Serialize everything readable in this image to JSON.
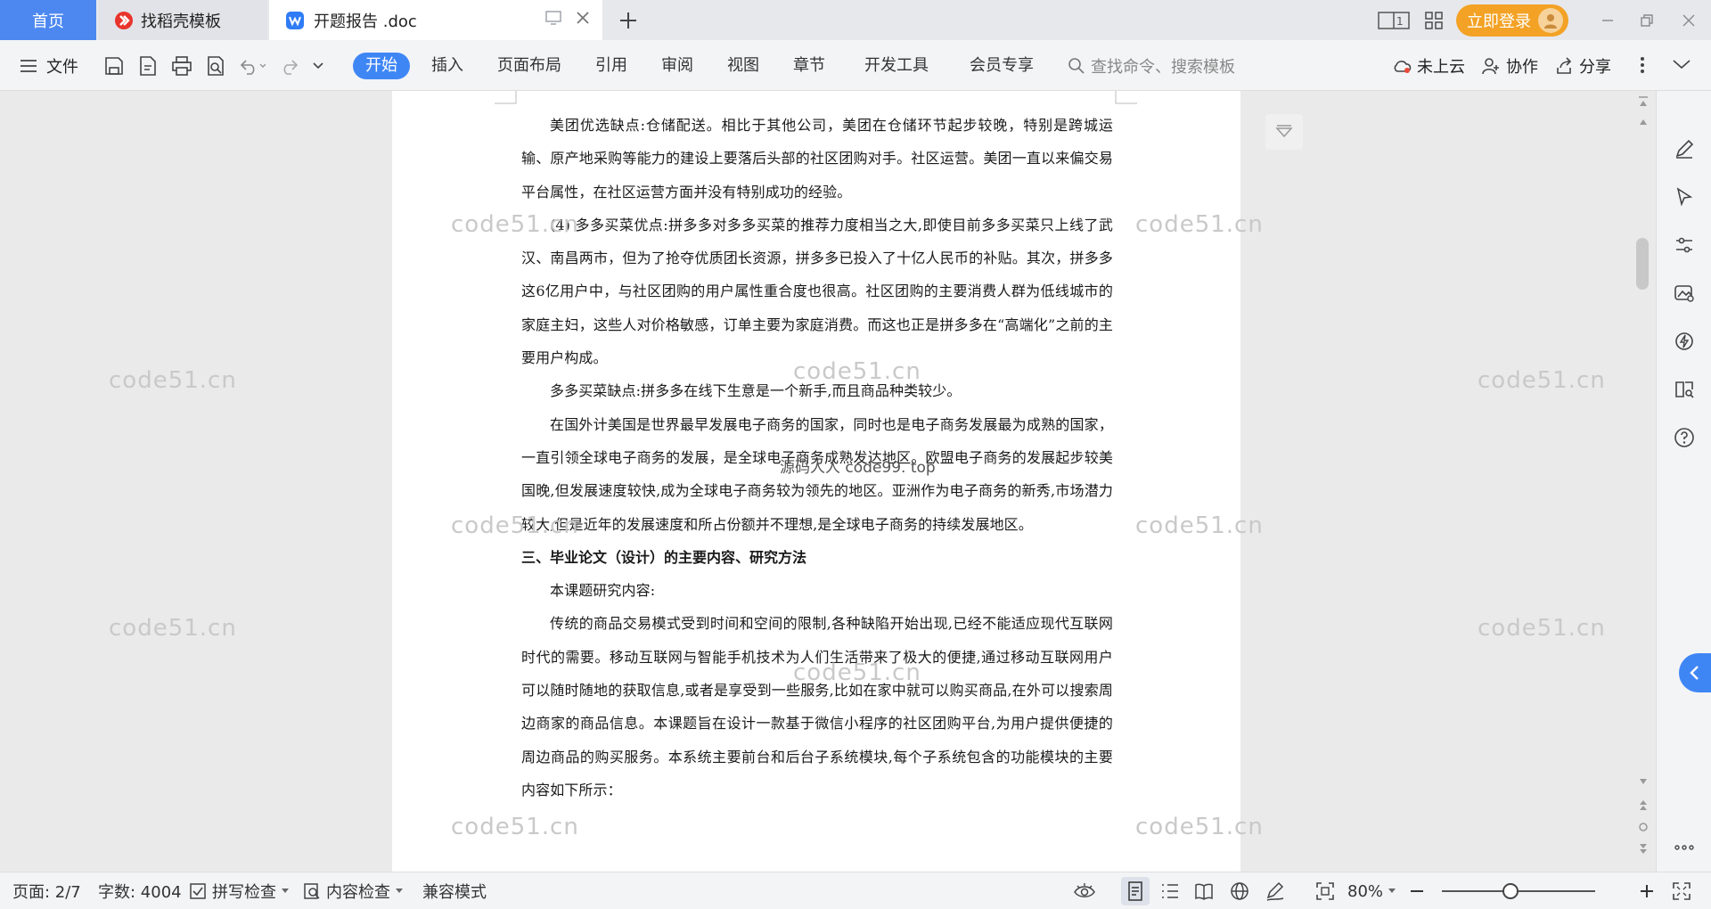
{
  "tabs": {
    "home": "首页",
    "daoke": "找稻壳模板",
    "doc": "开题报告 .doc",
    "new_tab": "+"
  },
  "titlebar": {
    "login": "立即登录"
  },
  "ribbon": {
    "file": "文件",
    "menu_tabs": [
      "开始",
      "插入",
      "页面布局",
      "引用",
      "审阅",
      "视图",
      "章节",
      "开发工具",
      "会员专享"
    ],
    "search_placeholder": "查找命令、搜索模板",
    "cloud": "未上云",
    "collab": "协作",
    "share": "分享"
  },
  "document": {
    "paragraphs": [
      {
        "type": "p",
        "indent": true,
        "text": "美团优选缺点:仓储配送。相比于其他公司，美团在仓储环节起步较晚，特别是跨城运输、原产地采购等能力的建设上要落后头部的社区团购对手。社区运营。美团一直以来偏交易平台属性，在社区运营方面并没有特别成功的经验。"
      },
      {
        "type": "p",
        "indent": true,
        "text": "(4)  多多买菜优点:拼多多对多多买菜的推荐力度相当之大,即使目前多多买菜只上线了武汉、南昌两市，但为了抢夺优质团长资源，拼多多已投入了十亿人民币的补贴。其次，拼多多这6亿用户中，与社区团购的用户属性重合度也很高。社区团购的主要消费人群为低线城市的家庭主妇，这些人对价格敏感，订单主要为家庭消费。而这也正是拼多多在“高端化”之前的主要用户构成。"
      },
      {
        "type": "p",
        "indent": true,
        "text": "多多买菜缺点:拼多多在线下生意是一个新手,而且商品种类较少。"
      },
      {
        "type": "p",
        "indent": true,
        "text": "在国外计美国是世界最早发展电子商务的国家，同时也是电子商务发展最为成熟的国家，一直引领全球电子商务的发展，是全球电子商务成熟发达地区。欧盟电子商务的发展起步较美国晚,但发展速度较快,成为全球电子商务较为领先的地区。亚洲作为电子商务的新秀,市场潜力较大,但是近年的发展速度和所占份额并不理想,是全球电子商务的持续发展地区。"
      },
      {
        "type": "h",
        "indent": false,
        "text": "三、毕业论文（设计）的主要内容、研究方法"
      },
      {
        "type": "p",
        "indent": true,
        "text": "本课题研究内容:"
      },
      {
        "type": "p",
        "indent": true,
        "text": "传统的商品交易模式受到时间和空间的限制,各种缺陷开始出现,已经不能适应现代互联网时代的需要。移动互联网与智能手机技术为人们生活带来了极大的便捷,通过移动互联网用户可以随时随地的获取信息,或者是享受到一些服务,比如在家中就可以购买商品,在外可以搜索周边商家的商品信息。本课题旨在设计一款基于微信小程序的社区团购平台,为用户提供便捷的周边商品的购买服务。本系统主要前台和后台子系统模块,每个子系统包含的功能模块的主要内容如下所示："
      }
    ]
  },
  "watermarks": {
    "text": "code51.cn",
    "center_text": "源码人人 code99. top"
  },
  "statusbar": {
    "page": "页面: 2/7",
    "words": "字数: 4004",
    "spell": "拼写检查",
    "content_check": "内容检查",
    "compat": "兼容模式",
    "zoom": "80%"
  }
}
